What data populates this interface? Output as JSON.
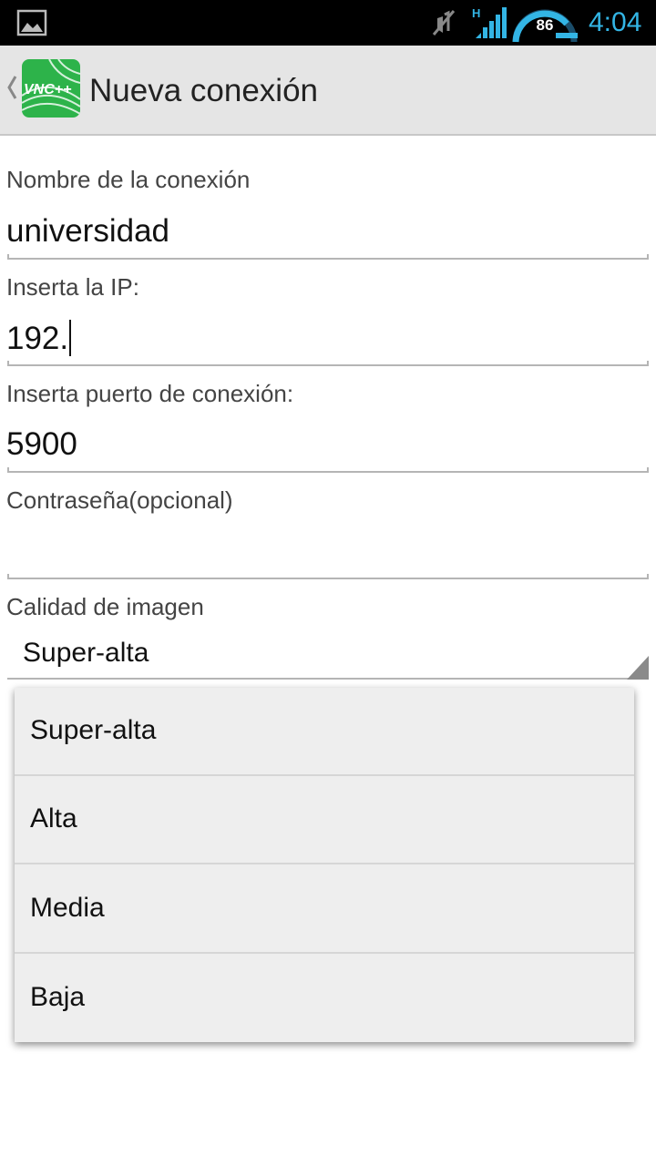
{
  "status_bar": {
    "time": "4:04",
    "battery": "86",
    "network_type": "H",
    "icons": [
      "gallery-icon",
      "mute-icon",
      "signal-icon",
      "battery-gauge-icon"
    ]
  },
  "action_bar": {
    "logo_text": "VNC++",
    "title": "Nueva conexión"
  },
  "form": {
    "name_label": "Nombre de la conexión",
    "name_value": "universidad",
    "ip_label": "Inserta la IP:",
    "ip_value": "192.",
    "port_label": "Inserta puerto de conexión:",
    "port_value": "5900",
    "password_label": "Contraseña(opcional)",
    "password_value": "",
    "quality_label": "Calidad de imagen",
    "quality_selected": "Super-alta"
  },
  "dropdown": {
    "options": [
      "Super-alta",
      "Alta",
      "Media",
      "Baja"
    ]
  },
  "colors": {
    "accent": "#33b5e5",
    "action_bar": "#e5e5e5",
    "logo_green": "#2db34a",
    "dropdown_bg": "#eeeeee"
  }
}
